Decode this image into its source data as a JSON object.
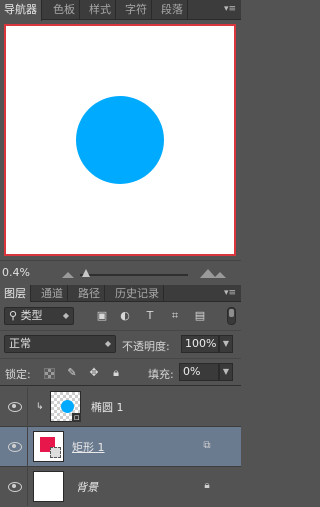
{
  "top_tabs": [
    "导航器",
    "色板",
    "样式",
    "字符",
    "段落"
  ],
  "navigator": {
    "zoom": "0.4%",
    "canvas_bg": "#ffffff",
    "view_frame_color": "#d9363e",
    "shape_color": "#00aaff"
  },
  "layer_tabs": [
    "图层",
    "通道",
    "路径",
    "历史记录"
  ],
  "filter": {
    "kind_label": "类型",
    "icons": [
      "image-filter-icon",
      "adjustment-filter-icon",
      "type-filter-icon",
      "shape-filter-icon",
      "smart-object-filter-icon"
    ]
  },
  "blend": {
    "mode": "正常",
    "opacity_label": "不透明度:",
    "opacity_value": "100%"
  },
  "lock": {
    "label": "锁定:",
    "fill_label": "填充:",
    "fill_value": "0%"
  },
  "layers": [
    {
      "name": "椭圆 1",
      "visible": true,
      "selected": false,
      "clipped": true
    },
    {
      "name": "矩形 1",
      "visible": true,
      "selected": true,
      "shape_color": "#e8174b"
    },
    {
      "name": "背景",
      "visible": true,
      "selected": false,
      "locked": true
    }
  ]
}
